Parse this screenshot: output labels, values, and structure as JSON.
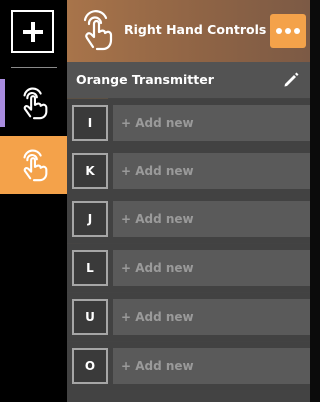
{
  "rail": {
    "add_icon": "plus-icon",
    "items": [
      {
        "icon": "hand-tap-icon",
        "active": false,
        "marker_color": "#a98de0"
      },
      {
        "icon": "hand-tap-icon",
        "active": true,
        "bg_color": "#f4a24a"
      }
    ]
  },
  "header": {
    "icon": "hand-tap-icon",
    "title": "Right Hand Controls",
    "more_icon": "ellipsis-icon",
    "accent": "#f4a24a"
  },
  "transmitter": {
    "name": "Orange Transmitter",
    "edit_icon": "pencil-icon"
  },
  "bindings": [
    {
      "key": "I",
      "placeholder": "+ Add new"
    },
    {
      "key": "K",
      "placeholder": "+ Add new"
    },
    {
      "key": "J",
      "placeholder": "+ Add new"
    },
    {
      "key": "L",
      "placeholder": "+ Add new"
    },
    {
      "key": "U",
      "placeholder": "+ Add new"
    },
    {
      "key": "O",
      "placeholder": "+ Add new"
    }
  ]
}
